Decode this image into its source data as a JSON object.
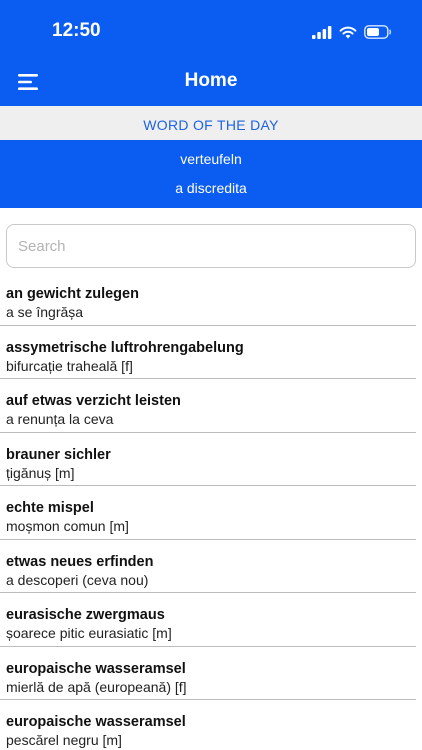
{
  "status": {
    "time": "12:50",
    "icons": [
      "signal-icon",
      "wifi-icon",
      "battery-icon"
    ]
  },
  "nav": {
    "title": "Home",
    "menu_icon": "hamburger-menu-icon"
  },
  "word_of_day": {
    "header": "WORD OF THE DAY",
    "word": "verteufeln",
    "translation": "a discredita"
  },
  "search": {
    "placeholder": "Search",
    "value": ""
  },
  "entries": [
    {
      "term": "an gewicht zulegen",
      "translation": "a se îngrășa"
    },
    {
      "term": "assymetrische luftrohrengabelung",
      "translation": "bifurcație traheală [f]"
    },
    {
      "term": "auf etwas verzicht leisten",
      "translation": "a renunța la ceva"
    },
    {
      "term": "brauner sichler",
      "translation": "țigănuș [m]"
    },
    {
      "term": "echte mispel",
      "translation": "moșmon comun [m]"
    },
    {
      "term": "etwas neues erfinden",
      "translation": "a descoperi (ceva nou)"
    },
    {
      "term": "eurasische zwergmaus",
      "translation": "șoarece pitic eurasiatic [m]"
    },
    {
      "term": "europaische wasseramsel",
      "translation": "mierlă de apă (europeană) [f]"
    },
    {
      "term": "europaische wasseramsel",
      "translation": "pescărel negru [m]"
    }
  ],
  "colors": {
    "primary": "#0b5cf0",
    "accent_text": "#1e63e0",
    "header_bg": "#efefef"
  }
}
